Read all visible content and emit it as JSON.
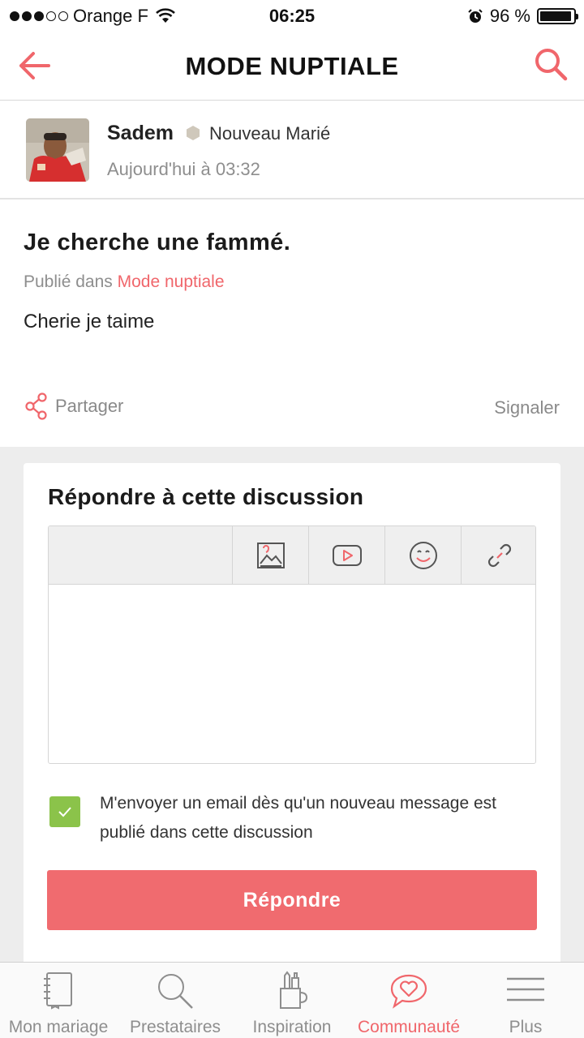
{
  "status_bar": {
    "carrier": "Orange F",
    "time": "06:25",
    "battery": "96 %",
    "battery_level": 0.96,
    "signal_bars": 3
  },
  "nav": {
    "title": "MODE NUPTIALE",
    "back_icon": "arrow-left-icon",
    "search_icon": "search-icon"
  },
  "author": {
    "name": "Sadem",
    "badge": "Nouveau Marié",
    "time": "Aujourd'hui à 03:32"
  },
  "post": {
    "title": "Je cherche une fammé.",
    "published_prefix": "Publié dans",
    "category": "Mode nuptiale",
    "body": "Cherie je taime"
  },
  "actions": {
    "share": "Partager",
    "report": "Signaler"
  },
  "reply": {
    "title": "Répondre à cette discussion",
    "toolbar": [
      "image-icon",
      "video-icon",
      "emoji-icon",
      "link-icon"
    ],
    "notify_checked": true,
    "notify_text": "M'envoyer un email dès qu'un nouveau message est publié dans cette discussion",
    "button": "Répondre"
  },
  "tabs": [
    {
      "label": "Mon mariage",
      "icon": "notebook-icon",
      "active": false
    },
    {
      "label": "Prestataires",
      "icon": "search-icon",
      "active": false
    },
    {
      "label": "Inspiration",
      "icon": "pencil-cup-icon",
      "active": false
    },
    {
      "label": "Communauté",
      "icon": "chat-heart-icon",
      "active": true
    },
    {
      "label": "Plus",
      "icon": "menu-icon",
      "active": false
    }
  ],
  "colors": {
    "accent": "#f0666b",
    "button": "#f06b6f",
    "checkbox": "#8bc34a",
    "muted": "#8e8e8e"
  }
}
